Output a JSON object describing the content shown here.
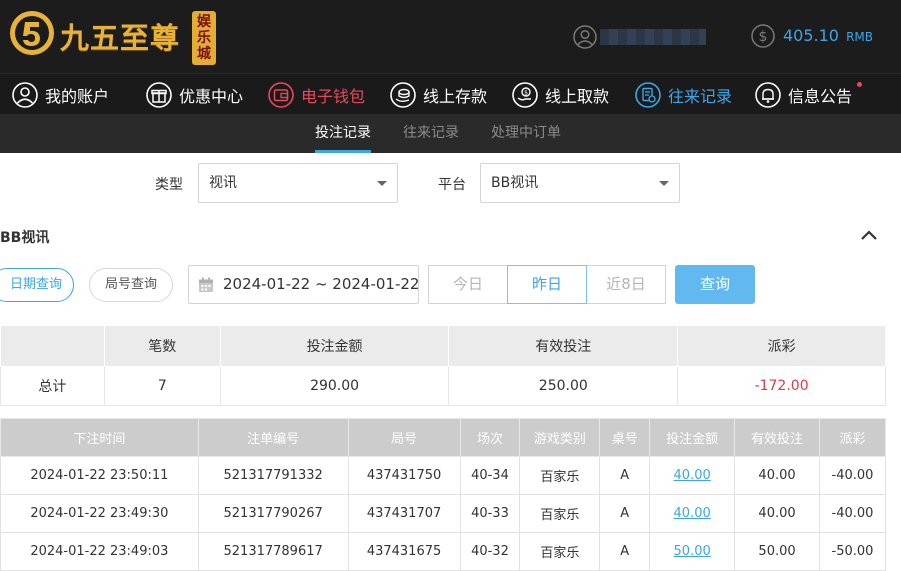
{
  "header": {
    "logo_text": "九五至尊",
    "logo_sub": [
      "娱",
      "乐",
      "城"
    ],
    "balance_value": "405.10",
    "balance_currency": "RMB"
  },
  "nav": [
    {
      "label": "我的账户",
      "icon": "user-icon"
    },
    {
      "label": "优惠中心",
      "icon": "gift-icon"
    },
    {
      "label": "电子钱包",
      "icon": "wallet-icon"
    },
    {
      "label": "线上存款",
      "icon": "deposit-icon"
    },
    {
      "label": "线上取款",
      "icon": "withdraw-icon"
    },
    {
      "label": "往来记录",
      "icon": "records-icon"
    },
    {
      "label": "信息公告",
      "icon": "bell-icon"
    }
  ],
  "colors": {
    "accent": "#3aa6e8",
    "wallet": "#e8495c",
    "negative": "#e0394a",
    "gold": "#e8b23a"
  },
  "subtabs": [
    "投注记录",
    "往来记录",
    "处理中订单"
  ],
  "filters": {
    "type_label": "类型",
    "type_value": "视讯",
    "platform_label": "平台",
    "platform_value": "BB视讯"
  },
  "section_title": "BB视讯",
  "query": {
    "date_mode": "日期查询",
    "round_mode": "局号查询",
    "date_range": "2024-01-22 ~ 2024-01-22",
    "quick": [
      "今日",
      "昨日",
      "近8日"
    ],
    "submit": "查询"
  },
  "summary": {
    "headers": [
      "",
      "笔数",
      "投注金额",
      "有效投注",
      "派彩"
    ],
    "row": [
      "总计",
      "7",
      "290.00",
      "250.00",
      "-172.00"
    ]
  },
  "detail": {
    "headers": [
      "下注时间",
      "注单编号",
      "局号",
      "场次",
      "游戏类别",
      "桌号",
      "投注金额",
      "有效投注",
      "派彩"
    ],
    "rows": [
      [
        "2024-01-22 23:50:11",
        "521317791332",
        "437431750",
        "40-34",
        "百家乐",
        "A",
        "40.00",
        "40.00",
        "-40.00"
      ],
      [
        "2024-01-22 23:49:30",
        "521317790267",
        "437431707",
        "40-33",
        "百家乐",
        "A",
        "40.00",
        "40.00",
        "-40.00"
      ],
      [
        "2024-01-22 23:49:03",
        "521317789617",
        "437431675",
        "40-32",
        "百家乐",
        "A",
        "50.00",
        "50.00",
        "-50.00"
      ]
    ]
  }
}
